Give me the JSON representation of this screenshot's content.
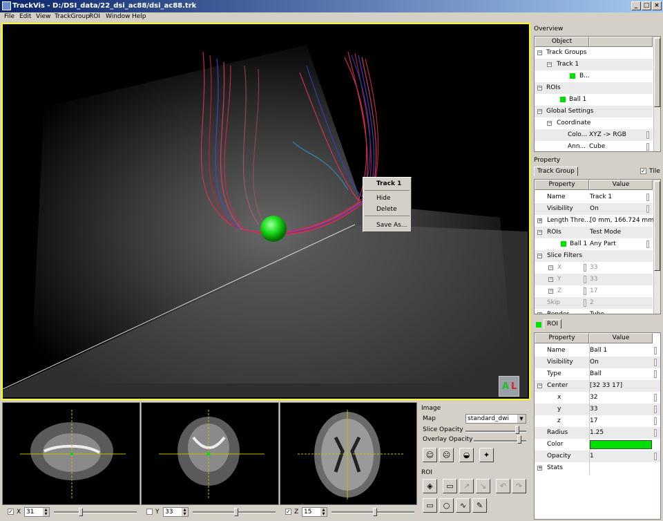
{
  "window": {
    "title": "TrackVis - D:/DSI_data/22_dsi_ac88/dsi_ac88.trk"
  },
  "menu": [
    "File",
    "Edit",
    "View",
    "TrackGroup",
    "ROI",
    "Window",
    "Help"
  ],
  "context_menu": {
    "header": "Track 1",
    "items": [
      "Hide",
      "Delete",
      "Save As..."
    ]
  },
  "orientation_cube": {
    "label_a": "A",
    "label_l": "L"
  },
  "sliders": [
    {
      "axis": "X",
      "checked": true,
      "value": "31",
      "fraction": 0.32
    },
    {
      "axis": "Y",
      "checked": false,
      "value": "33",
      "fraction": 0.53
    },
    {
      "axis": "Z",
      "checked": true,
      "value": "15",
      "fraction": 0.53
    }
  ],
  "image_panel": {
    "title": "Image",
    "map_label": "Map",
    "map_value": "standard_dwi",
    "slice_opacity_label": "Slice Opacity",
    "slice_opacity_level": 0.88,
    "overlay_opacity_label": "Overlay Opacity",
    "overlay_opacity_level": 0.9,
    "roi_title": "ROI"
  },
  "overview": {
    "title": "Overview",
    "column": "Object",
    "rows": [
      {
        "label": "Track Groups"
      },
      {
        "label": "Track 1"
      },
      {
        "label": "B..."
      },
      {
        "label": "ROIs"
      },
      {
        "label": "Ball 1"
      },
      {
        "label": "Global Settings"
      },
      {
        "label": "Coordinate"
      },
      {
        "label": "Colo...",
        "value": "XYZ -> RGB"
      },
      {
        "label": "Ann...",
        "value": "Cube"
      }
    ]
  },
  "property": {
    "title": "Property",
    "tab": "Track Group",
    "tile_label": "Tile",
    "tile_checked": true,
    "col_property": "Property",
    "col_value": "Value",
    "rows": [
      {
        "name": "Name",
        "value": "Track 1"
      },
      {
        "name": "Visibility",
        "value": "On"
      },
      {
        "name": "Length Thre...",
        "value": "[0 mm,  166.724 mm]"
      },
      {
        "name": "ROIs",
        "value": "Test Mode"
      },
      {
        "name": "Ball 1",
        "value": "Any Part"
      },
      {
        "name": "Slice Filters",
        "value": ""
      },
      {
        "name": "X",
        "value": "33"
      },
      {
        "name": "Y",
        "value": "33"
      },
      {
        "name": "Z",
        "value": "17"
      },
      {
        "name": "Skip",
        "value": "2"
      },
      {
        "name": "Render",
        "value": "Tube"
      }
    ]
  },
  "roi_panel": {
    "tab": "ROI",
    "col_property": "Property",
    "col_value": "Value",
    "rows": [
      {
        "name": "Name",
        "value": "Ball 1"
      },
      {
        "name": "Visibility",
        "value": "On"
      },
      {
        "name": "Type",
        "value": "Ball"
      },
      {
        "name": "Center",
        "value": "[32 33 17]"
      },
      {
        "name": "x",
        "value": "32"
      },
      {
        "name": "y",
        "value": "33"
      },
      {
        "name": "z",
        "value": "17"
      },
      {
        "name": "Radius",
        "value": "1.25"
      },
      {
        "name": "Color",
        "value": ""
      },
      {
        "name": "Opacity",
        "value": "1"
      },
      {
        "name": "Stats",
        "value": ""
      }
    ],
    "color_hex": "#00e000"
  },
  "colors": {
    "accent_yellow": "#ffff00",
    "roi_green": "#00e000",
    "title_bar": "#0a246a"
  }
}
